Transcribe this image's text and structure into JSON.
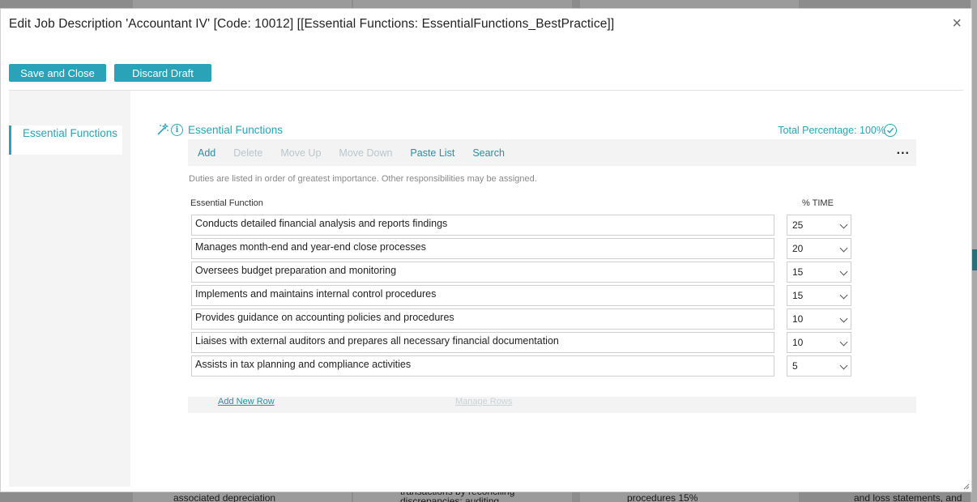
{
  "modal": {
    "title": "Edit Job Description 'Accountant IV'  [Code: 10012] [[Essential Functions: EssentialFunctions_BestPractice]]",
    "close_glyph": "×"
  },
  "actions": {
    "save_label": "Save and Close",
    "discard_label": "Discard Draft"
  },
  "sidebar": {
    "items": [
      {
        "label": "Essential Functions",
        "active": true
      }
    ]
  },
  "section": {
    "title": "Essential Functions",
    "total_percentage": "Total Percentage: 100%",
    "icons": [
      "magic-wand-icon",
      "info-icon",
      "check-circle-icon"
    ]
  },
  "toolbar": {
    "add": "Add",
    "delete": "Delete",
    "move_up": "Move Up",
    "move_down": "Move Down",
    "paste_list": "Paste List",
    "search": "Search",
    "more": "..."
  },
  "note": "Duties are listed in order of greatest importance. Other responsibilities may be assigned.",
  "table": {
    "col_function": "Essential Function",
    "col_time": "% TIME",
    "rows": [
      {
        "function": "Conducts detailed financial analysis and reports findings",
        "time": "25"
      },
      {
        "function": "Manages month-end and year-end close processes",
        "time": "20"
      },
      {
        "function": "Oversees budget preparation and monitoring",
        "time": "15"
      },
      {
        "function": "Implements and maintains internal control procedures",
        "time": "15"
      },
      {
        "function": "Provides guidance on accounting policies and procedures",
        "time": "10"
      },
      {
        "function": "Liaises with external auditors and prepares all necessary financial documentation",
        "time": "10"
      },
      {
        "function": "Assists in tax planning and compliance activities",
        "time": "5"
      }
    ]
  },
  "footer": {
    "add_row": "Add New Row",
    "manage_rows": "Manage Rows"
  },
  "background": {
    "snippets": [
      "associated depreciation",
      "transactions by reconciling",
      "discrepancies; auditing",
      "procedures 15%",
      "and loss statements, and"
    ]
  },
  "colors": {
    "accent": "#2aa3b8",
    "overlay": "#8c8c8c"
  }
}
